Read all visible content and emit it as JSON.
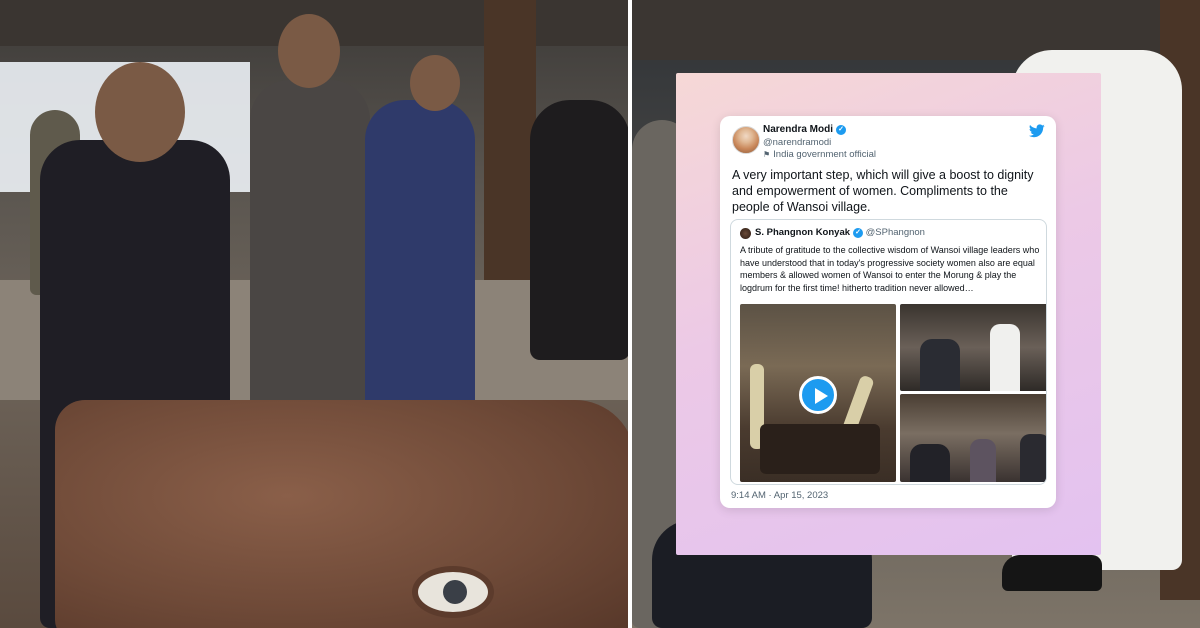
{
  "tweet": {
    "author_name": "Narendra Modi",
    "author_handle": "@narendramodi",
    "official_label": "India government official",
    "text": "A very important step, which will give a boost to dignity and empowerment of women. Compliments to the people of Wansoi village.",
    "timestamp": "9:14 AM · Apr 15, 2023"
  },
  "quoted_tweet": {
    "author_name": "S. Phangnon Konyak",
    "author_handle": "@SPhangnon",
    "text": "A tribute of gratitude to the collective wisdom of Wansoi village leaders who have understood that in today's progressive society women also are equal members & allowed women of Wansoi to enter the Morung & play the logdrum for the first time! hitherto tradition never allowed…"
  },
  "icons": {
    "verified": "verified-badge-icon",
    "twitter": "twitter-bird-icon",
    "official": "flag-icon",
    "play": "play-icon"
  },
  "colors": {
    "accent": "#1d9bf0",
    "frame_gradient_start": "#f6d8d6",
    "frame_gradient_end": "#e3c2f0"
  }
}
